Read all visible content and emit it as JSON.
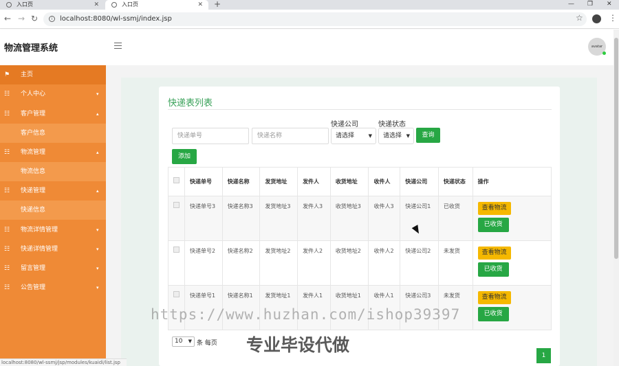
{
  "browser": {
    "tabs": [
      {
        "label": "入口页"
      },
      {
        "label": "入口页"
      }
    ],
    "url": "localhost:8080/wl-ssmj/index.jsp"
  },
  "header": {
    "brand": "物流管理系统",
    "avatar_text": "avatar"
  },
  "sidebar": {
    "items": [
      {
        "label": "主页",
        "icon": "flag-icon"
      },
      {
        "label": "个人中心",
        "icon": "grid-icon"
      },
      {
        "label": "客户管理",
        "icon": "grid-icon"
      },
      {
        "label": "客户信息",
        "icon": ""
      },
      {
        "label": "物流管理",
        "icon": "grid-icon"
      },
      {
        "label": "物流信息",
        "icon": ""
      },
      {
        "label": "快递管理",
        "icon": "grid-icon"
      },
      {
        "label": "快递信息",
        "icon": ""
      },
      {
        "label": "物流详情管理",
        "icon": "grid-icon"
      },
      {
        "label": "快递详情管理",
        "icon": "grid-icon"
      },
      {
        "label": "留言管理",
        "icon": "grid-icon"
      },
      {
        "label": "公告管理",
        "icon": "grid-icon"
      }
    ]
  },
  "main": {
    "title": "快递表列表",
    "search": {
      "tracking_placeholder": "快递单号",
      "name_placeholder": "快递名称",
      "company_label": "快递公司",
      "company_value": "请选择",
      "status_label": "快递状态",
      "status_value": "请选择",
      "query_label": "查询"
    },
    "add_label": "添加",
    "table": {
      "headers": [
        "快递单号",
        "快递名称",
        "发货地址",
        "发件人",
        "收货地址",
        "收件人",
        "快递公司",
        "快递状态",
        "操作"
      ],
      "rows": [
        {
          "c": [
            "快递单号3",
            "快递名称3",
            "发货地址3",
            "发件人3",
            "收货地址3",
            "收件人3",
            "快递公司1",
            "已收货"
          ],
          "view": "查看物流",
          "action": "已收货"
        },
        {
          "c": [
            "快递单号2",
            "快递名称2",
            "发货地址2",
            "发件人2",
            "收货地址2",
            "收件人2",
            "快递公司2",
            "未发货"
          ],
          "view": "查看物流",
          "action": "已收货"
        },
        {
          "c": [
            "快递单号1",
            "快递名称1",
            "发货地址1",
            "发件人1",
            "收货地址1",
            "收件人1",
            "快递公司3",
            "未发货"
          ],
          "view": "查看物流",
          "action": "已收货"
        }
      ]
    },
    "pager": {
      "page_size": "10",
      "page_size_suffix": "条 每页",
      "current_page": "1"
    }
  },
  "status_bar": "localhost:8080/wl-ssmj/jsp/modules/kuaidi/list.jsp",
  "watermarks": {
    "url": "https://www.huzhan.com/ishop39397",
    "text": "专业毕设代做"
  },
  "colors": {
    "sidebar": "#ef8a36",
    "primary": "#27a744",
    "warning": "#f5b800",
    "title": "#3aa25a"
  }
}
